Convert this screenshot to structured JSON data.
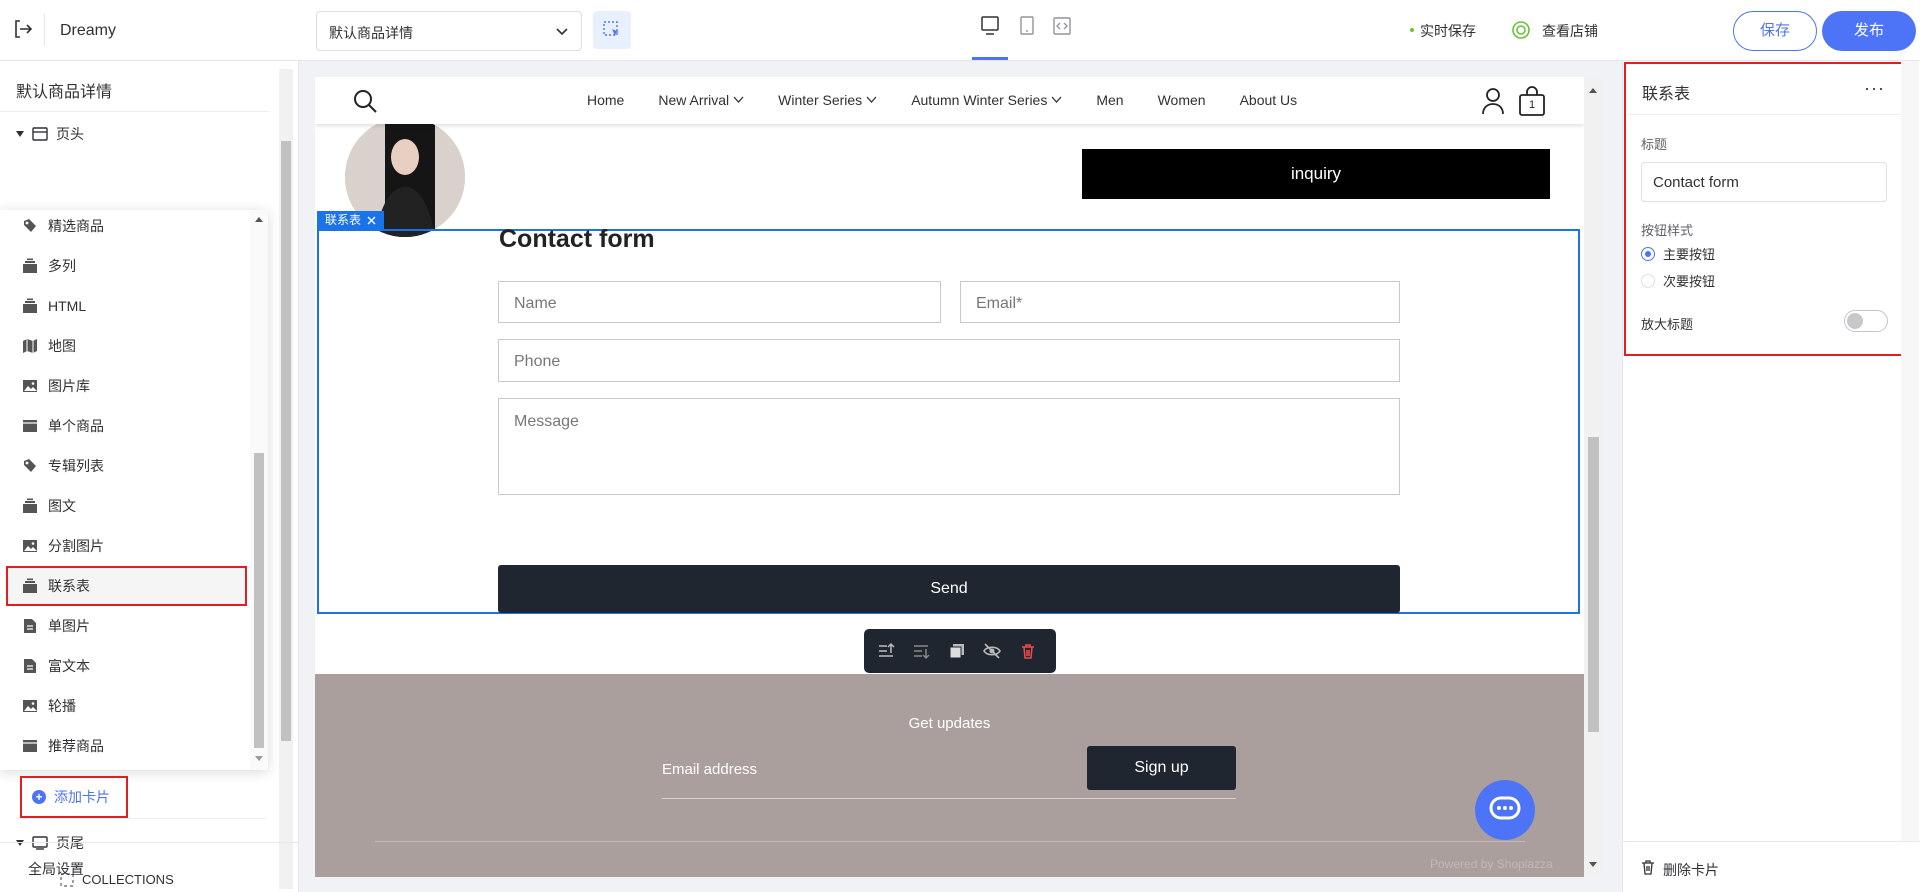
{
  "topbar": {
    "brand": "Dreamy",
    "template_select": "默认商品详情",
    "saving_status": "实时保存",
    "view_shop": "查看店铺",
    "save_label": "保存",
    "publish_label": "发布"
  },
  "left_panel": {
    "title": "默认商品详情",
    "header_group": "页头",
    "footer_group": "页尾",
    "footer_child": "COLLECTIONS",
    "add_card": "添加卡片",
    "global_settings": "全局设置",
    "menu_items": [
      {
        "label": "精选商品",
        "icon": "tag-icon"
      },
      {
        "label": "多列",
        "icon": "stack-icon"
      },
      {
        "label": "HTML",
        "icon": "stack-icon"
      },
      {
        "label": "地图",
        "icon": "map-icon"
      },
      {
        "label": "图片库",
        "icon": "image-icon"
      },
      {
        "label": "单个商品",
        "icon": "box-icon"
      },
      {
        "label": "专辑列表",
        "icon": "tag-icon"
      },
      {
        "label": "图文",
        "icon": "stack-icon"
      },
      {
        "label": "分割图片",
        "icon": "image-icon"
      },
      {
        "label": "联系表",
        "icon": "stack-icon"
      },
      {
        "label": "单图片",
        "icon": "doc-icon"
      },
      {
        "label": "富文本",
        "icon": "doc-icon"
      },
      {
        "label": "轮播",
        "icon": "image-icon"
      },
      {
        "label": "推荐商品",
        "icon": "box-icon"
      }
    ]
  },
  "store_nav": {
    "links": [
      "Home",
      "New Arrival",
      "Winter Series",
      "Autumn Winter Series",
      "Men",
      "Women",
      "About Us"
    ],
    "cart_count": "1"
  },
  "canvas": {
    "inquiry_label": "inquiry",
    "section_tag": "联系表",
    "contact_title": "Contact form",
    "name_placeholder": "Name",
    "email_placeholder": "Email*",
    "phone_placeholder": "Phone",
    "message_placeholder": "Message",
    "send_label": "Send",
    "footer": {
      "get_updates": "Get updates",
      "email_placeholder": "Email address",
      "signup_label": "Sign up",
      "powered": "Powered by Shoplazza"
    }
  },
  "right_panel": {
    "title": "联系表",
    "more": "···",
    "title_label": "标题",
    "title_value": "Contact form",
    "button_style_label": "按钮样式",
    "primary_button": "主要按钮",
    "secondary_button": "次要按钮",
    "enlarge_title": "放大标题",
    "delete_card": "删除卡片"
  },
  "colors": {
    "accent": "#4d74f7",
    "highlight": "#e02020",
    "selection": "#1a73e8",
    "footer_bg": "#ab9f9e",
    "dark_button": "#1f2630"
  }
}
